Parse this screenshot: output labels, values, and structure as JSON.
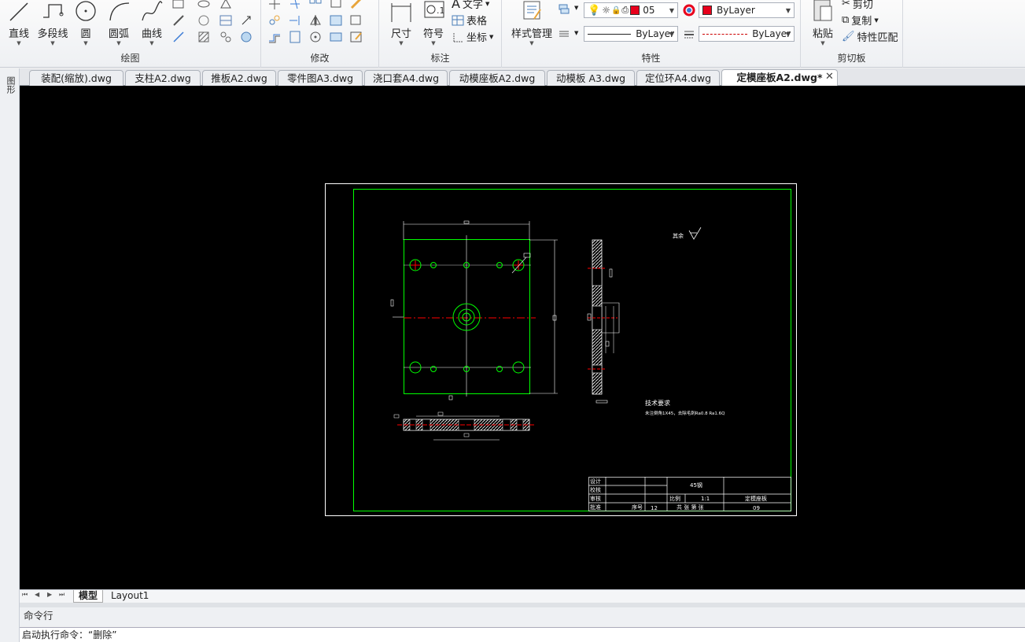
{
  "ribbon": {
    "draw": {
      "title": "绘图",
      "tools": [
        "直线",
        "多段线",
        "圆",
        "圆弧",
        "曲线"
      ]
    },
    "modify": {
      "title": "修改"
    },
    "annotate": {
      "title": "标注",
      "tools": [
        "尺寸",
        "符号"
      ],
      "text_label": "文字",
      "table_label": "表格",
      "coord_label": "坐标"
    },
    "properties": {
      "title": "特性",
      "style_manager": "样式管理",
      "layer_value": "05",
      "color_value": "ByLayer",
      "linetype_value": "ByLayer",
      "lineweight_value": "ByLayer",
      "color_swatch": "#e8001c"
    },
    "clipboard": {
      "title": "剪切板",
      "paste": "粘贴",
      "cut": "剪切",
      "copy": "复制",
      "match": "特性匹配"
    }
  },
  "tabs": [
    "装配(缩放).dwg",
    "支柱A2.dwg",
    "推板A2.dwg",
    "零件图A3.dwg",
    "浇口套A4.dwg",
    "动模座板A2.dwg",
    "动模板 A3.dwg",
    "定位环A4.dwg",
    "定模座板A2.dwg*"
  ],
  "active_tab_index": 8,
  "left_strip_label": "图形",
  "layout_tabs": [
    "模型",
    "Layout1"
  ],
  "command": {
    "title": "命令行",
    "last_line": "启动执行命令：“删除”"
  },
  "drawing": {
    "tech_req_title": "技术要求",
    "tech_req_body": "未注倒角1X45，去除毛刺Ra0.8 Ra1.6Q",
    "roughness_note": "其余",
    "title_block": {
      "material": "45钢",
      "scale_label": "比例",
      "scale_value": "1:1",
      "part_name": "定模座板",
      "sheet_text": "共  张  第  张",
      "drawing_no": "09",
      "rows": [
        "设计",
        "校核",
        "审核",
        "批准"
      ],
      "count_label": "序号",
      "count_value": "12"
    }
  },
  "colors": {
    "canvas_bg": "#000000",
    "frame_white": "#ffffff",
    "border_green": "#00ff00",
    "center_red": "#ff0000"
  }
}
